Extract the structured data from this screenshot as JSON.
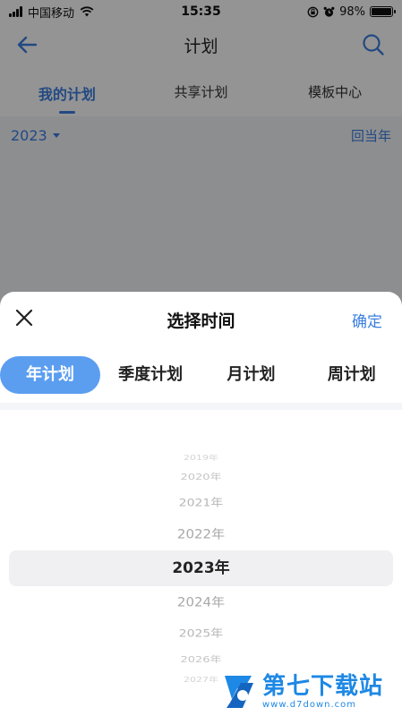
{
  "status_bar": {
    "carrier": "中国移动",
    "time": "15:35",
    "battery": "98%",
    "battery_level": 0.98
  },
  "nav": {
    "title": "计划",
    "back_icon": "back-arrow-icon",
    "search_icon": "search-icon"
  },
  "tabs": [
    {
      "label": "我的计划",
      "active": true
    },
    {
      "label": "共享计划",
      "active": false
    },
    {
      "label": "模板中心",
      "active": false
    }
  ],
  "year_row": {
    "year": "2023",
    "back_label": "回当年"
  },
  "sheet": {
    "title": "选择时间",
    "confirm_label": "确定",
    "close_icon": "close-icon",
    "plan_tabs": [
      {
        "label": "年计划",
        "active": true
      },
      {
        "label": "季度计划",
        "active": false
      },
      {
        "label": "月计划",
        "active": false
      },
      {
        "label": "周计划",
        "active": false
      }
    ],
    "years": [
      "2019年",
      "2020年",
      "2021年",
      "2022年",
      "2023年",
      "2024年",
      "2025年",
      "2026年",
      "2027年"
    ],
    "selected_year": "2023年"
  },
  "watermark": {
    "name": "第七下载站",
    "url": "www.d7down.com"
  },
  "colors": {
    "accent": "#3b7fe0",
    "tab_active_bg": "#5b9ef0",
    "watermark": "#1e88e5"
  }
}
